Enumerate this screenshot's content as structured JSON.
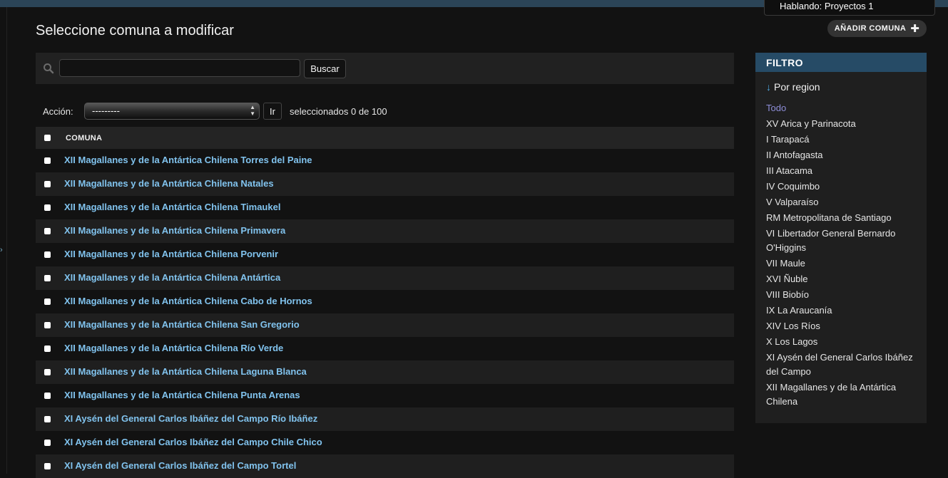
{
  "tooltip": {
    "text": "Hablando: Proyectos 1"
  },
  "page": {
    "title": "Seleccione comuna a modificar"
  },
  "add_button": {
    "label": "AÑADIR COMUNA"
  },
  "search": {
    "value": "",
    "placeholder": "",
    "button_label": "Buscar"
  },
  "actions": {
    "label": "Acción:",
    "select_value": "---------",
    "go_label": "Ir",
    "counter": "seleccionados 0 de 100"
  },
  "table": {
    "header": "COMUNA",
    "rows": [
      "XII Magallanes y de la Antártica Chilena Torres del Paine",
      "XII Magallanes y de la Antártica Chilena Natales",
      "XII Magallanes y de la Antártica Chilena Timaukel",
      "XII Magallanes y de la Antártica Chilena Primavera",
      "XII Magallanes y de la Antártica Chilena Porvenir",
      "XII Magallanes y de la Antártica Chilena Antártica",
      "XII Magallanes y de la Antártica Chilena Cabo de Hornos",
      "XII Magallanes y de la Antártica Chilena San Gregorio",
      "XII Magallanes y de la Antártica Chilena Río Verde",
      "XII Magallanes y de la Antártica Chilena Laguna Blanca",
      "XII Magallanes y de la Antártica Chilena Punta Arenas",
      "XI Aysén del General Carlos Ibáñez del Campo Río Ibáñez",
      "XI Aysén del General Carlos Ibáñez del Campo Chile Chico",
      "XI Aysén del General Carlos Ibáñez del Campo Tortel"
    ]
  },
  "filter": {
    "title": "FILTRO",
    "subtitle": "Por region",
    "selected_index": 0,
    "items": [
      "Todo",
      "XV Arica y Parinacota",
      "I Tarapacá",
      "II Antofagasta",
      "III Atacama",
      "IV Coquimbo",
      "V Valparaíso",
      "RM Metropolitana de Santiago",
      "VI Libertador General Bernardo O'Higgins",
      "VII Maule",
      "XVI Ñuble",
      "VIII Biobío",
      "IX La Araucanía",
      "XIV Los Ríos",
      "X Los Lagos",
      "XI Aysén del General Carlos Ibáñez del Campo",
      "XII Magallanes y de la Antártica Chilena"
    ]
  },
  "colors": {
    "background": "#121212",
    "topbar": "#2b4457",
    "link": "#81c3ee",
    "filter_header": "#264b66",
    "selected_filter": "#8e8ed8"
  },
  "icons": [
    "search-icon",
    "plus-icon",
    "arrow-down-icon",
    "select-arrows-icon"
  ]
}
